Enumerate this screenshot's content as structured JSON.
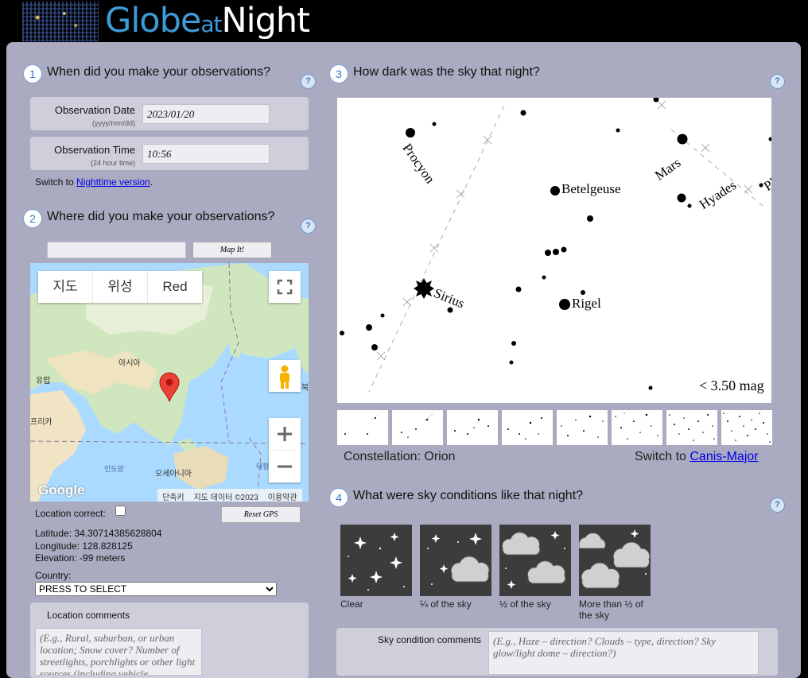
{
  "header": {
    "logo_globe": "Globe",
    "logo_at": "at",
    "logo_night": "Night"
  },
  "help_symbol": "?",
  "step1": {
    "num": "1",
    "title": "When did you make your observations?",
    "date_label": "Observation Date",
    "date_sub": "(yyyy/mm/dd)",
    "date_value": "2023/01/20",
    "time_label": "Observation Time",
    "time_sub": "(24 hour time)",
    "time_value": "10:56",
    "switch_prefix": "Switch to ",
    "switch_link": "Nighttime version",
    "switch_suffix": "."
  },
  "step2": {
    "num": "2",
    "title": "Where did you make your observations?",
    "search_value": "",
    "map_button": "Map It!",
    "map": {
      "tabs": [
        "지도",
        "위성",
        "Red"
      ],
      "labels": {
        "asia": "아시아",
        "europe": "유럽",
        "africa": "프리카",
        "indian_ocean": "인도양",
        "oceania": "오세아니아",
        "pacific": "태평",
        "north": "북"
      },
      "footer": [
        "단축키",
        "지도 데이터 ©2023",
        "이용약관"
      ],
      "google": "Google"
    },
    "location_correct_label": "Location correct:",
    "reset_gps": "Reset GPS",
    "latitude": "Latitude: 34.30714385628804",
    "longitude": "Longitude: 128.828125",
    "elevation": "Elevation: -99 meters",
    "country_label": "Country:",
    "country_value": "PRESS TO SELECT",
    "comments_label": "Location comments",
    "comments_placeholder": "(E.g., Rural, suburban, or urban location; Snow cover? Number of streetlights, porchlights or other light sources (including vehicle"
  },
  "step3": {
    "num": "3",
    "title": "How dark was the sky that night?",
    "stars": {
      "procyon": "Procyon",
      "betelgeuse": "Betelgeuse",
      "mars": "Mars",
      "hyades": "Hyades",
      "pleiades_partial": "Pl",
      "sirius": "Sirius",
      "rigel": "Rigel",
      "magnitude": "< 3.50 mag"
    },
    "constellation": "Constellation: Orion",
    "switch_prefix": "Switch to ",
    "switch_link": "Canis-Major"
  },
  "step4": {
    "num": "4",
    "title": "What were sky conditions like that night?",
    "conditions": [
      "Clear",
      "¼ of the sky",
      "½ of the sky",
      "More than ½ of the sky"
    ],
    "comments_label": "Sky condition comments",
    "comments_placeholder": "(E.g., Haze – direction? Clouds – type, direction? Sky glow/light dome – direction?)"
  }
}
